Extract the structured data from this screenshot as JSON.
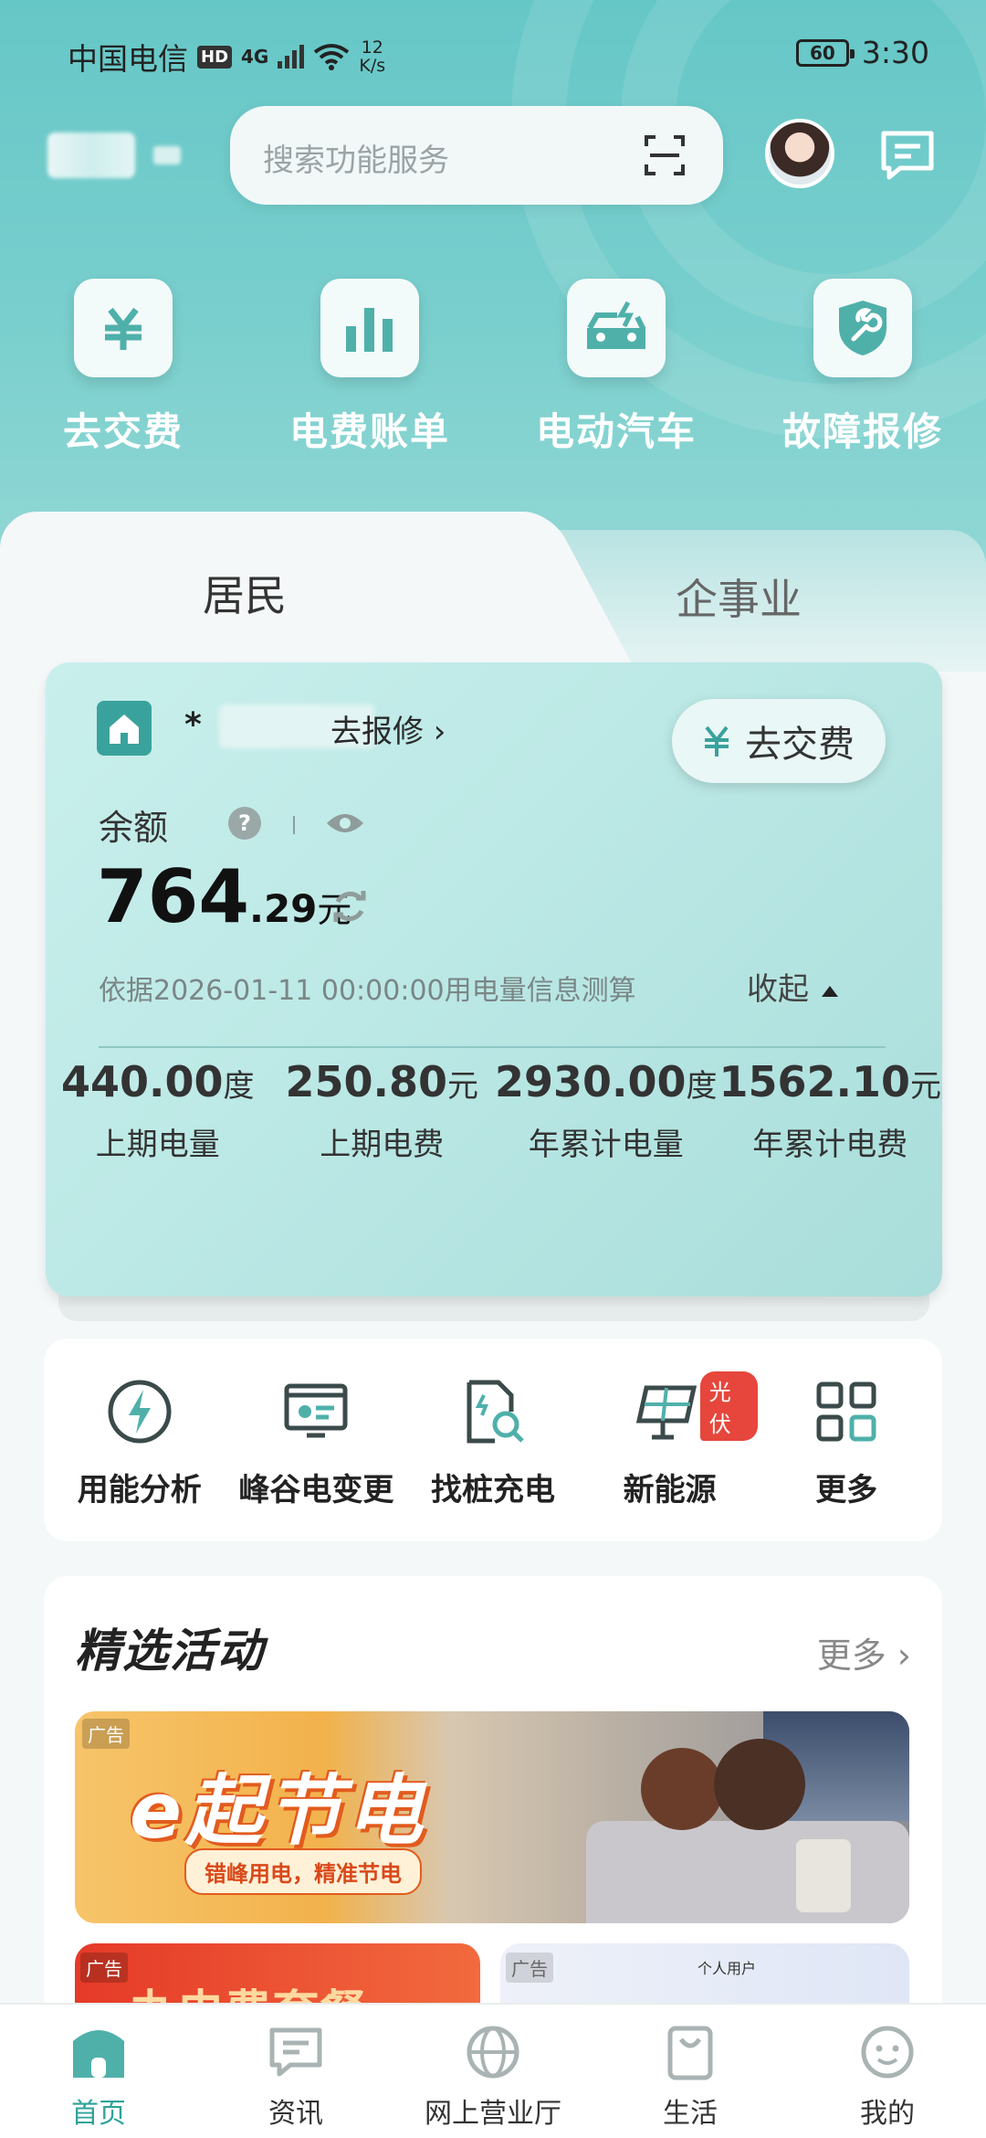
{
  "status_bar": {
    "carrier": "中国电信",
    "hd": "HD",
    "network": "4G",
    "speed_value": "12",
    "speed_unit": "K/s",
    "battery": "60",
    "time": "3:30"
  },
  "header": {
    "search_placeholder": "搜索功能服务",
    "icons": [
      "scan-icon",
      "avatar",
      "message-icon"
    ]
  },
  "top_functions": [
    {
      "label": "去交费",
      "icon": "yuan-icon"
    },
    {
      "label": "电费账单",
      "icon": "bar-chart-icon"
    },
    {
      "label": "电动汽车",
      "icon": "ev-charging-icon"
    },
    {
      "label": "故障报修",
      "icon": "wrench-shield-icon"
    }
  ],
  "tabs": {
    "active": "居民",
    "inactive": "企事业"
  },
  "account_card": {
    "masked_account": "*",
    "repair_link": "去报修 ›",
    "pay_button": "去交费",
    "balance_label": "余额",
    "help_symbol": "?",
    "balance_int": "764",
    "balance_dec": ".29",
    "balance_unit": "元",
    "calc_note": "依据2026-01-11 00:00:00用电量信息测算",
    "collapse_label": "收起",
    "stats": [
      {
        "value": "440.00",
        "unit": "度",
        "label": "上期电量"
      },
      {
        "value": "250.80",
        "unit": "元",
        "label": "上期电费"
      },
      {
        "value": "2930.00",
        "unit": "度",
        "label": "年累计电量"
      },
      {
        "value": "1562.10",
        "unit": "元",
        "label": "年累计电费"
      }
    ]
  },
  "services": [
    {
      "label": "用能分析",
      "icon": "lightning-icon"
    },
    {
      "label": "峰谷电变更",
      "icon": "monitor-card-icon"
    },
    {
      "label": "找桩充电",
      "icon": "document-search-icon"
    },
    {
      "label": "新能源",
      "icon": "solar-panel-icon",
      "badge": "光伏"
    },
    {
      "label": "更多",
      "icon": "grid-icon"
    }
  ],
  "activities": {
    "title": "精选活动",
    "more": "更多",
    "banner": {
      "ad_tag": "广告",
      "title": "e起节电",
      "subtitle": "错峰用电，精准节电"
    },
    "card_a": {
      "ad_tag": "广告",
      "title": "办电费套餐"
    },
    "card_b": {
      "ad_tag": "广告",
      "title": "个人用户"
    }
  },
  "bottom_nav": [
    {
      "label": "首页",
      "icon": "home-icon",
      "active": true
    },
    {
      "label": "资讯",
      "icon": "chat-bubble-icon",
      "active": false
    },
    {
      "label": "网上营业厅",
      "icon": "globe-icon",
      "active": false
    },
    {
      "label": "生活",
      "icon": "shopping-bag-icon",
      "active": false
    },
    {
      "label": "我的",
      "icon": "profile-face-icon",
      "active": false
    }
  ],
  "colors": {
    "brand_teal": "#66c7c7",
    "card_teal": "#bde9e6",
    "active_nav": "#2ea39b",
    "badge_red": "#e6463c"
  }
}
